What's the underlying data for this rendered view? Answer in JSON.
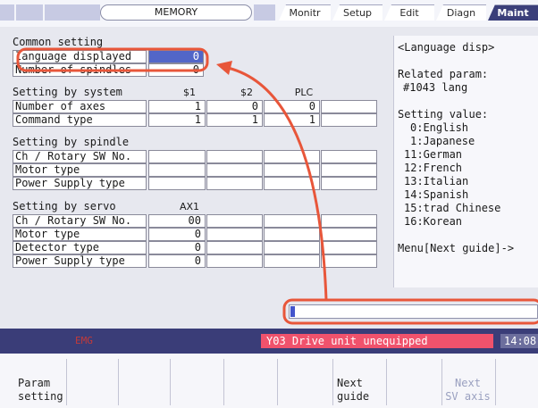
{
  "header": {
    "mode": "MEMORY",
    "tabs": [
      "Monitr",
      "Setup",
      "Edit",
      "Diagn",
      "Maint"
    ],
    "active_tab": "Maint"
  },
  "common": {
    "heading": "Common setting",
    "language_label": "language displayed",
    "language_value": "0",
    "spindles_label": "Number of spindles",
    "spindles_value": "0"
  },
  "system": {
    "heading": "Setting by system",
    "cols": [
      "$1",
      "$2",
      "PLC"
    ],
    "rows": [
      {
        "label": "Number of axes",
        "values": [
          "1",
          "0",
          "0"
        ]
      },
      {
        "label": "Command type",
        "values": [
          "1",
          "1",
          "1"
        ]
      }
    ]
  },
  "spindle": {
    "heading": "Setting by spindle",
    "rows": [
      "Ch / Rotary SW No.",
      "Motor type",
      "Power Supply type"
    ]
  },
  "servo": {
    "heading": "Setting by servo",
    "col": "AX1",
    "rows": [
      {
        "label": "Ch / Rotary SW No.",
        "value": "00"
      },
      {
        "label": "Motor type",
        "value": "0"
      },
      {
        "label": "Detector type",
        "value": "0"
      },
      {
        "label": "Power Supply type",
        "value": "0"
      }
    ]
  },
  "guide": {
    "title": "<Language disp>",
    "related_label": "Related param:",
    "related_value": "#1043 lang",
    "setting_label": "Setting value:",
    "options": [
      "0:English",
      "1:Japanese",
      "11:German",
      "12:French",
      "13:Italian",
      "14:Spanish",
      "15:trad Chinese",
      "16:Korean"
    ],
    "menu_hint": "Menu[Next guide]->"
  },
  "status": {
    "left_text": "EMG",
    "alarm": "Y03  Drive unit unequipped",
    "clock": "14:08"
  },
  "menu": {
    "keys": [
      {
        "line1": "Param",
        "line2": "setting"
      },
      {
        "line1": "",
        "line2": ""
      },
      {
        "line1": "",
        "line2": ""
      },
      {
        "line1": "",
        "line2": ""
      },
      {
        "line1": "",
        "line2": ""
      },
      {
        "line1": "",
        "line2": ""
      },
      {
        "line1": "Next",
        "line2": "guide"
      },
      {
        "line1": "",
        "line2": ""
      },
      {
        "line1": "Next",
        "line2": "SV axis"
      },
      {
        "line1": "",
        "line2": ""
      }
    ]
  },
  "colors": {
    "annotation": "#e8563a",
    "alarm_bg": "#f0526c",
    "status_bg": "#3a3d78",
    "highlight": "#5266c8"
  }
}
